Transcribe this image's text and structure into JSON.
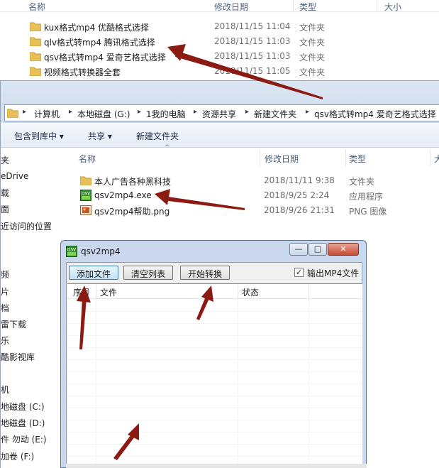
{
  "back_window": {
    "headers": {
      "name": "名称",
      "date": "修改日期",
      "type": "类型",
      "size": "大小"
    },
    "items": [
      {
        "name": "kux格式mp4 优酷格式选择",
        "date": "2018/11/15 11:04",
        "type": "文件夹"
      },
      {
        "name": "qlv格式转mp4  腾讯格式选择",
        "date": "2018/11/15 11:03",
        "type": "文件夹"
      },
      {
        "name": "qsv格式转mp4  爱奇艺格式选择",
        "date": "2018/11/15 11:03",
        "type": "文件夹"
      },
      {
        "name": "视频格式转换器全套",
        "date": "2018/11/15 11:05",
        "type": "文件夹"
      }
    ]
  },
  "front_window": {
    "breadcrumb": [
      "计算机",
      "本地磁盘 (G:)",
      "1我的电脑",
      "资源共享",
      "新建文件夹",
      "qsv格式转mp4  爱奇艺格式选择"
    ],
    "toolbar": {
      "include_library": "包含到库中 ▾",
      "share": "共享 ▾",
      "new_folder": "新建文件夹"
    },
    "sidebar": [
      "夹",
      "eDrive",
      "载",
      "面",
      "近访问的位置",
      "频",
      "片",
      "档",
      "雷下载",
      "乐",
      "酷影视库",
      "机",
      "地磁盘 (C:)",
      "地磁盘 (D:)",
      "件 勿动 (E:)",
      "加卷 (F:)"
    ],
    "headers": {
      "name": "名称",
      "date": "修改日期",
      "type": "类型",
      "size": "大"
    },
    "items": [
      {
        "name": "本人广告各种黑科技",
        "date": "2018/11/11 9:38",
        "type": "文件夹",
        "icon": "folder-icon"
      },
      {
        "name": "qsv2mp4.exe",
        "date": "2018/9/25 2:24",
        "type": "应用程序",
        "icon": "app-icon"
      },
      {
        "name": "qsv2mp4帮助.png",
        "date": "2018/9/26 21:31",
        "type": "PNG 图像",
        "icon": "image-icon"
      }
    ]
  },
  "dialog": {
    "title": "qsv2mp4",
    "window_buttons": {
      "minimize": "—",
      "maximize": "□",
      "close": "✕"
    },
    "buttons": {
      "add_file": "添加文件",
      "clear_list": "清空列表",
      "start_convert": "开始转换"
    },
    "checkbox": {
      "label": "输出MP4文件",
      "checked": true,
      "mark": "✓"
    },
    "columns": {
      "index": "序号",
      "file": "文件",
      "status": "状态"
    }
  },
  "colors": {
    "arrow": "#8b1a13",
    "folder": "#e8c05a",
    "title_bar": "#c9d8ec"
  }
}
